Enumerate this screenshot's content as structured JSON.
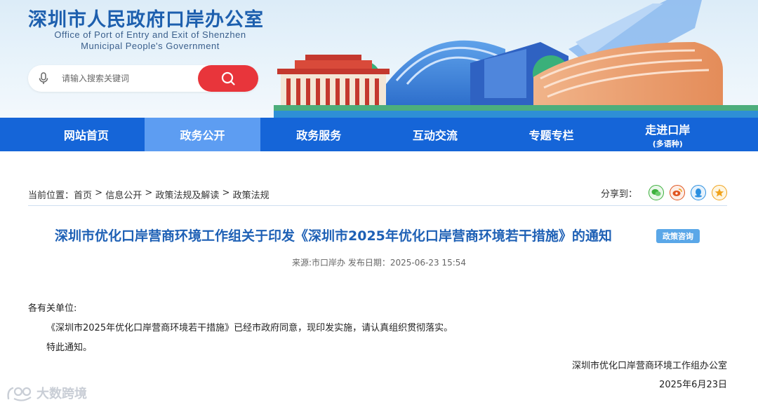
{
  "header": {
    "site_title": "深圳市人民政府口岸办公室",
    "site_subtitle_line1": "Office of Port of Entry and Exit of Shenzhen",
    "site_subtitle_line2": "Municipal People's Government",
    "search": {
      "placeholder": "请输入搜索关键词",
      "icon": "search-icon",
      "mic_icon": "microphone-icon"
    },
    "colors": {
      "brand_blue": "#1565d8",
      "search_red": "#e8353b",
      "title_blue": "#1d5fae"
    }
  },
  "nav": {
    "items": [
      {
        "label": "网站首页"
      },
      {
        "label": "政务公开",
        "active": true
      },
      {
        "label": "政务服务"
      },
      {
        "label": "互动交流"
      },
      {
        "label": "专题专栏"
      },
      {
        "label": "走进口岸",
        "sub": "(多语种)"
      }
    ]
  },
  "breadcrumb": {
    "prefix": "当前位置：",
    "items": [
      "首页",
      "信息公开",
      "政策法规及解读",
      "政策法规"
    ],
    "separator": " > "
  },
  "share": {
    "label": "分享到：",
    "buttons": [
      {
        "icon": "wechat-icon",
        "color": "#3db03d"
      },
      {
        "icon": "weibo-icon",
        "color": "#e0541f"
      },
      {
        "icon": "qq-icon",
        "color": "#2a8fe0"
      },
      {
        "icon": "favorite-star-icon",
        "color": "#f0a21b"
      }
    ]
  },
  "article": {
    "title": "深圳市优化口岸营商环境工作组关于印发《深圳市2025年优化口岸营商环境若干措施》的通知",
    "badge": "政策咨询",
    "source_label": "来源:",
    "source": "市口岸办",
    "date_label": "发布日期：",
    "date": "2025-06-23 15:54",
    "salutation": "各有关单位:",
    "paragraph1": "《深圳市2025年优化口岸营商环境若干措施》已经市政府同意，现印发实施，请认真组织贯彻落实。",
    "paragraph2": "特此通知。",
    "signature_org": "深圳市优化口岸营商环境工作组办公室",
    "signature_date": "2025年6月23日"
  },
  "watermark": {
    "text": "大数跨境",
    "icon": "logo-icon"
  }
}
